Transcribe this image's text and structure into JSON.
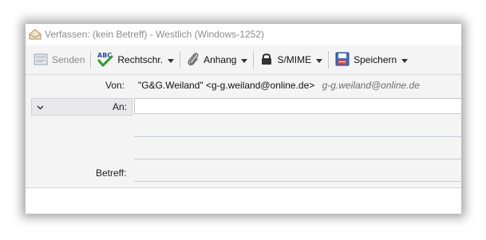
{
  "window": {
    "title": "Verfassen: (kein Betreff) - Westlich (Windows-1252)",
    "app_icon": "compose-window-icon"
  },
  "toolbar": {
    "send_label": "Senden",
    "spell_label": "Rechtschr.",
    "attach_label": "Anhang",
    "smime_label": "S/MIME",
    "save_label": "Speichern",
    "icons": [
      "send-icon",
      "spellcheck-icon",
      "paperclip-icon",
      "lock-icon",
      "floppy-disk-icon",
      "dropdown-arrow-icon"
    ]
  },
  "headers": {
    "from_label": "Von:",
    "from_identity": "\"G&G.Weiland\" <g-g.weiland@online.de>",
    "from_alt": "g-g.weiland@online.de",
    "recipient_type": "An:",
    "recipient_value": "",
    "subject_label": "Betreff:",
    "subject_value": ""
  },
  "colors": {
    "window_bg": "#f4f4f5",
    "title_text": "#8c8c8c",
    "accent_blue": "#2b6cc4"
  }
}
